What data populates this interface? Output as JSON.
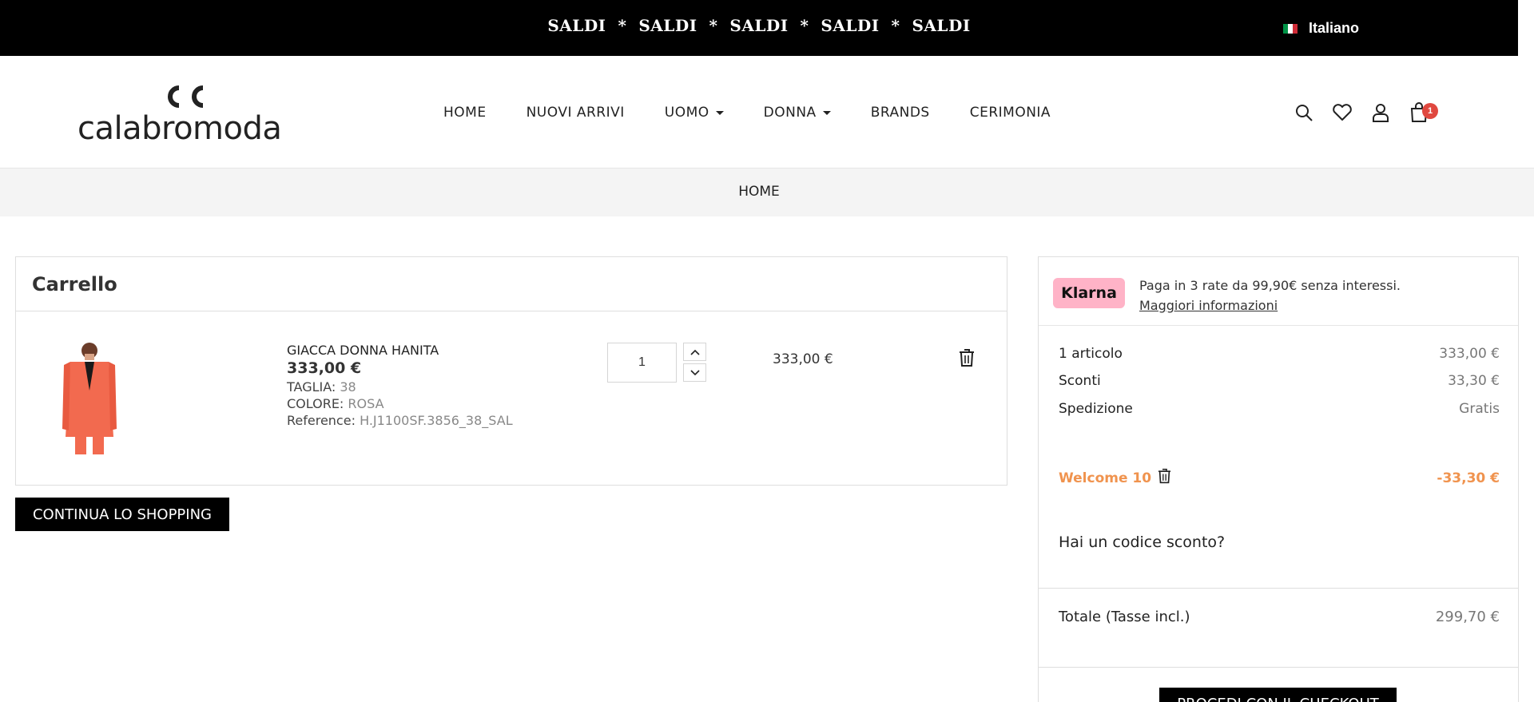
{
  "promo_bar": {
    "text": "SALDI  *  SALDI  *  SALDI  *  SALDI  *  SALDI",
    "language": "Italiano",
    "flag_colors": [
      "#009246",
      "#ffffff",
      "#ce2b37"
    ]
  },
  "header": {
    "logo_text": "calabromoda",
    "nav": [
      {
        "label": "HOME",
        "dropdown": false
      },
      {
        "label": "NUOVI ARRIVI",
        "dropdown": false
      },
      {
        "label": "UOMO",
        "dropdown": true
      },
      {
        "label": "DONNA",
        "dropdown": true
      },
      {
        "label": "BRANDS",
        "dropdown": false
      },
      {
        "label": "CERIMONIA",
        "dropdown": false
      }
    ],
    "icons": [
      "search-icon",
      "heart-icon",
      "user-icon",
      "shopping-bag-icon"
    ],
    "cart_count": "1"
  },
  "breadcrumb": {
    "label": "HOME"
  },
  "cart": {
    "title": "Carrello",
    "item": {
      "name": "GIACCA DONNA HANITA",
      "price": "333,00 €",
      "size_label": "TAGLIA:",
      "size_value": "38",
      "color_label": "COLORE:",
      "color_value": "ROSA",
      "ref_label": "Reference:",
      "ref_value": "H.J1100SF.3856_38_SAL",
      "quantity": "1",
      "line_total": "333,00 €",
      "image_color": "#f26a4f"
    },
    "continue_label": "CONTINUA LO SHOPPING"
  },
  "summary": {
    "klarna_badge": "Klarna",
    "klarna_text": "Paga in 3 rate da 99,90€ senza interessi.",
    "klarna_link": "Maggiori informazioni",
    "lines": [
      {
        "label": "1 articolo",
        "value": "333,00 €"
      },
      {
        "label": "Sconti",
        "value": "33,30 €"
      },
      {
        "label": "Spedizione",
        "value": "Gratis"
      }
    ],
    "voucher_name": "Welcome 10",
    "voucher_value": "-33,30 €",
    "promo_question": "Hai un codice sconto?",
    "total_label": "Totale (Tasse incl.)",
    "total_value": "299,70 €",
    "checkout_label": "PROCEDI CON IL CHECKOUT",
    "accent_color": "#f0934e"
  }
}
